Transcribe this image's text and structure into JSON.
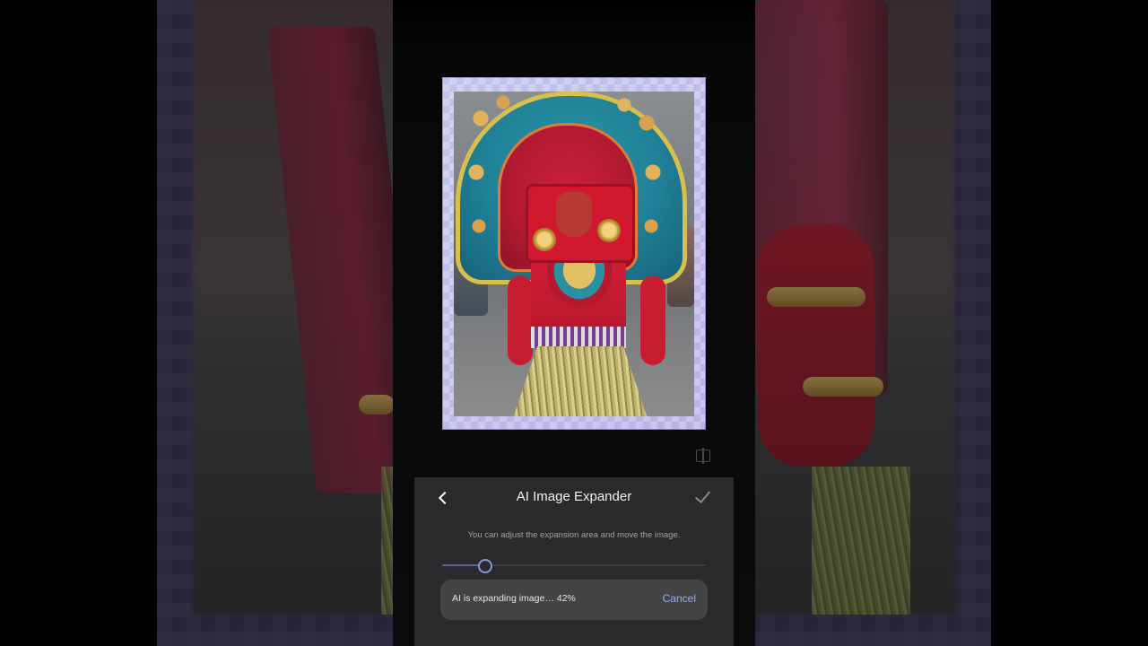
{
  "editor": {
    "title": "AI Image Expander",
    "hint": "You can adjust the expansion area and move the image.",
    "progress_text": "AI is expanding image… 42%",
    "progress_value": 42,
    "cancel_label": "Cancel",
    "expansion_slider_value": 0.16
  },
  "colors": {
    "sheet_background": "#2a2a2c",
    "accent": "#9aa6ef",
    "progress_pill": "#444446"
  },
  "icons": {
    "back": "chevron-left-icon",
    "confirm": "checkmark-icon",
    "compare": "compare-icon"
  }
}
